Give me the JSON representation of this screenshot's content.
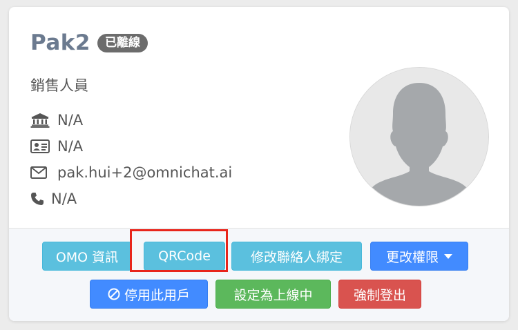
{
  "profile": {
    "name": "Pak2",
    "status_badge": "已離線",
    "role": "銷售人員",
    "info": [
      {
        "icon": "bank-icon",
        "value": "N/A"
      },
      {
        "icon": "id-card-icon",
        "value": "N/A"
      },
      {
        "icon": "envelope-icon",
        "value": "pak.hui+2@omnichat.ai"
      },
      {
        "icon": "phone-icon",
        "value": "N/A"
      }
    ],
    "avatar": "default-avatar"
  },
  "actions": {
    "omo_info": "OMO 資訊",
    "qrcode": "QRCode",
    "modify_binding": "修改聯絡人綁定",
    "change_permission": "更改權限",
    "disable_user": "停用此用戶",
    "set_online": "設定為上線中",
    "force_logout": "強制登出"
  },
  "colors": {
    "info": "#5bc0de",
    "primary": "#428bff",
    "success": "#5cb85c",
    "danger": "#d9534f",
    "badge": "#6c6c6c",
    "highlight": "#e8251b"
  }
}
